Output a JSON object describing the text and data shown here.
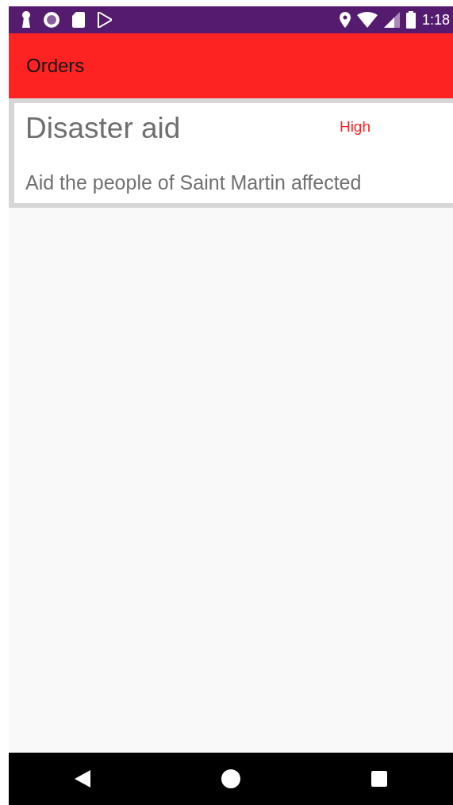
{
  "status_bar": {
    "time": "1:18"
  },
  "app_bar": {
    "title": "Orders"
  },
  "orders": [
    {
      "title": "Disaster aid",
      "priority": "High",
      "description": "Aid the people of Saint Martin affected"
    }
  ]
}
